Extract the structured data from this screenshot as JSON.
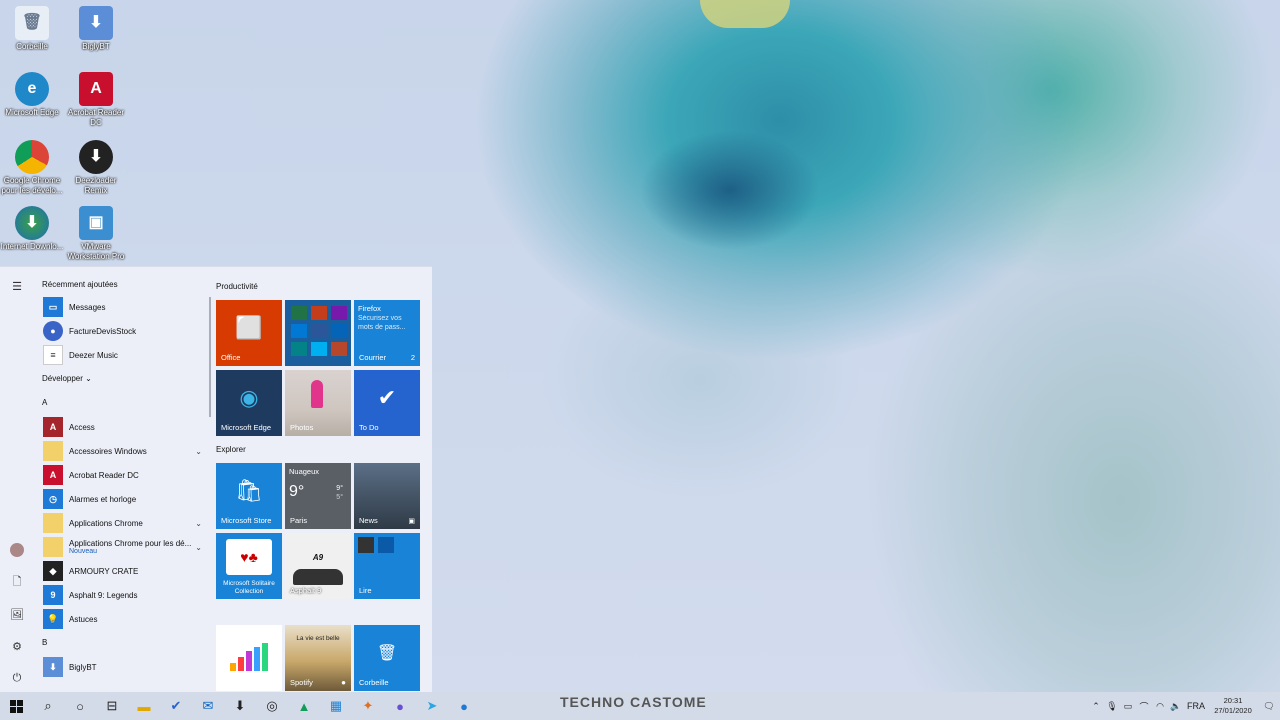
{
  "desktop": {
    "icons": [
      {
        "label": "Corbeille",
        "icon": "recycle-bin-icon"
      },
      {
        "label": "BiglyBT",
        "icon": "biglybt-icon"
      },
      {
        "label": "Microsoft Edge",
        "icon": "edge-icon"
      },
      {
        "label": "Acrobat Reader DC",
        "icon": "acrobat-icon"
      },
      {
        "label": "Google Chrome pour les dévelo...",
        "icon": "chrome-dev-icon"
      },
      {
        "label": "Deezloader Remix",
        "icon": "download-icon"
      },
      {
        "label": "Internet Downlo...",
        "icon": "idm-icon"
      },
      {
        "label": "VMware Workstation Pro",
        "icon": "vmware-icon"
      }
    ]
  },
  "start_menu": {
    "recent_header": "Récemment ajoutées",
    "recent": [
      "Messages",
      "FactureDevisStock",
      "Deezer Music"
    ],
    "expand_label": "Développer",
    "letter_a": "A",
    "apps_a": [
      {
        "label": "Access"
      },
      {
        "label": "Accessoires Windows"
      },
      {
        "label": "Acrobat Reader DC"
      },
      {
        "label": "Alarmes et horloge"
      },
      {
        "label": "Applications Chrome"
      },
      {
        "label": "Applications Chrome pour les dé...",
        "sub": "Nouveau"
      },
      {
        "label": "ARMOURY CRATE"
      },
      {
        "label": "Asphalt 9: Legends"
      },
      {
        "label": "Astuces"
      }
    ],
    "letter_b": "B",
    "apps_b": [
      {
        "label": "BiglyBT"
      }
    ],
    "groups": {
      "productivite": "Productivité",
      "explorer": "Explorer"
    },
    "tiles": {
      "office": "Office",
      "firefox_title": "Firefox",
      "firefox_text": "Sécurisez vos mots de pass...",
      "courrier": "Courrier",
      "courrier_count": "2",
      "edge": "Microsoft Edge",
      "photos": "Photos",
      "todo": "To Do",
      "store": "Microsoft Store",
      "weather_cond": "Nuageux",
      "weather_temp": "9°",
      "weather_hi": "9°",
      "weather_lo": "5°",
      "weather_city": "Paris",
      "news": "News",
      "solitaire": "Microsoft Solitaire Collection",
      "asphalt": "Asphalt 9",
      "lire": "Lire",
      "spotify_text": "La vie est belle",
      "spotify": "Spotify",
      "corbeille": "Corbeille"
    }
  },
  "taskbar": {
    "watermark": "TECHNO CASTOME",
    "language": "FRA",
    "time": "20:31",
    "date": "27/01/2020"
  },
  "colors": {
    "accent": "#0078d7",
    "office": "#d83b01",
    "edge_tile": "#1e3a5f",
    "todo": "#2564cf",
    "weather": "#5a5f66"
  }
}
